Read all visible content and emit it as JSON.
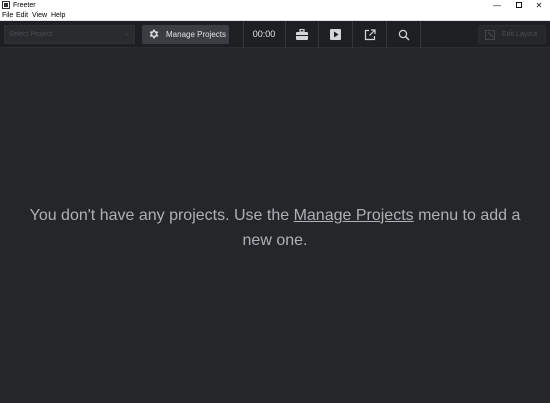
{
  "window": {
    "title": "Freeter",
    "minimize_glyph": "—",
    "close_glyph": "✕"
  },
  "menu": {
    "items": [
      {
        "label": "File"
      },
      {
        "label": "Edit"
      },
      {
        "label": "View"
      },
      {
        "label": "Help"
      }
    ]
  },
  "toolbar": {
    "project_select_placeholder": "Select Project",
    "project_select_caret": "⌄",
    "manage_projects_label": "Manage Projects",
    "timer": "00:00",
    "icons": [
      "toolbox-icon",
      "play-icon",
      "external-link-icon",
      "search-icon"
    ],
    "edit_layout_label": "Edit Layout"
  },
  "main": {
    "message_before": "You don't have any projects. Use the ",
    "message_link": "Manage Projects",
    "message_after": " menu to add a new one."
  },
  "colors": {
    "background": "#252629",
    "toolbar": "#1e1f22",
    "button": "#3b3d42",
    "text": "#aeb0b5"
  }
}
